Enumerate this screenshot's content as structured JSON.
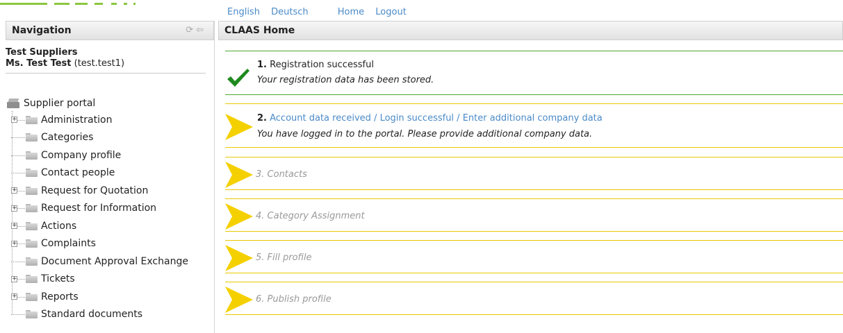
{
  "top_links": [
    "English",
    "Deutsch",
    "Home",
    "Logout"
  ],
  "navigation": {
    "title": "Navigation",
    "company": "Test Suppliers",
    "user_name": "Ms. Test Test",
    "user_login": "(test.test1)",
    "root_label": "Supplier portal",
    "items": [
      {
        "label": "Administration",
        "expandable": true
      },
      {
        "label": "Categories",
        "expandable": false
      },
      {
        "label": "Company profile",
        "expandable": false
      },
      {
        "label": "Contact people",
        "expandable": false
      },
      {
        "label": "Request for Quotation",
        "expandable": true
      },
      {
        "label": "Request for Information",
        "expandable": true
      },
      {
        "label": "Actions",
        "expandable": true
      },
      {
        "label": "Complaints",
        "expandable": true
      },
      {
        "label": "Document Approval Exchange",
        "expandable": false
      },
      {
        "label": "Tickets",
        "expandable": true
      },
      {
        "label": "Reports",
        "expandable": true
      },
      {
        "label": "Standard documents",
        "expandable": false
      }
    ]
  },
  "main": {
    "title": "CLAAS Home",
    "steps": [
      {
        "number": "1.",
        "title": "Registration successful",
        "description": "Your registration data has been stored.",
        "status": "done"
      },
      {
        "number": "2.",
        "title": "Account data received / Login successful / Enter additional company data",
        "description": "You have logged in to the portal. Please provide additional company data.",
        "status": "active"
      },
      {
        "number": "",
        "title": "3. Contacts",
        "description": "",
        "status": "pending"
      },
      {
        "number": "",
        "title": "4. Category Assignment",
        "description": "",
        "status": "pending"
      },
      {
        "number": "",
        "title": "5. Fill profile",
        "description": "",
        "status": "pending"
      },
      {
        "number": "",
        "title": "6. Publish profile",
        "description": "",
        "status": "pending"
      }
    ]
  },
  "colors": {
    "done": "#1e8a1e",
    "arrow": "#f5d000",
    "link": "#4a8ac8",
    "green_line": "#4fa832",
    "yellow_line": "#e8c800"
  }
}
